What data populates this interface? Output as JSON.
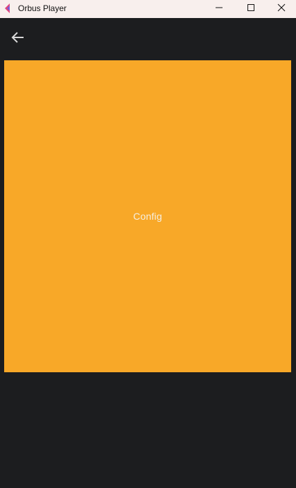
{
  "window": {
    "title": "Orbus Player",
    "app_icon": "orbus-logo-icon",
    "controls": {
      "minimize_icon": "minimize-icon",
      "maximize_icon": "maximize-icon",
      "close_icon": "close-icon"
    }
  },
  "appbar": {
    "back_icon": "arrow-left-icon"
  },
  "main": {
    "config_label": "Config"
  },
  "colors": {
    "background": "#1c1d1f",
    "titlebar": "#f8efed",
    "config_panel": "#f8a828",
    "config_text": "#f6efe2",
    "back_arrow": "#d8d8d8",
    "logo_left": "#e0457b",
    "logo_right": "#7b5bd6"
  }
}
